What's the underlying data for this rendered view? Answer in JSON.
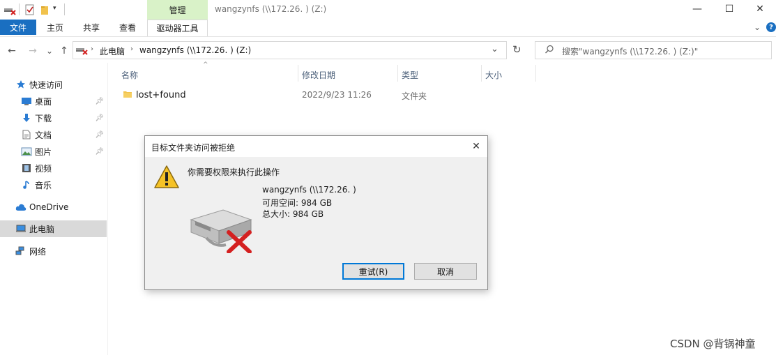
{
  "window": {
    "title": "wangzynfs (\\\\172.26.            ) (Z:)",
    "context_tab": "管理",
    "minimize_glyph": "—",
    "maximize_glyph": "☐",
    "close_glyph": "✕"
  },
  "ribbon": {
    "tabs": [
      "文件",
      "主页",
      "共享",
      "查看",
      "驱动器工具"
    ],
    "file_tab_color": "#1a6fc1",
    "context_tab_color": "#d9f2c8"
  },
  "nav": {
    "back": "←",
    "forward": "→",
    "recent": "⌄",
    "up": "↑"
  },
  "address": {
    "segments": [
      "此电脑",
      "wangzynfs (\\\\172.26.            ) (Z:)"
    ],
    "dropdown": "⌄",
    "refresh": "↻"
  },
  "search": {
    "placeholder": "搜索\"wangzynfs (\\\\172.26.            ) (Z:)\""
  },
  "columns": {
    "name": "名称",
    "date": "修改日期",
    "type": "类型",
    "size": "大小"
  },
  "files": [
    {
      "name": "lost+found",
      "date": "2022/9/23 11:26",
      "type": "文件夹",
      "size": ""
    }
  ],
  "sidebar": {
    "quick_access": "快速访问",
    "items": [
      {
        "label": "桌面",
        "icon": "desktop-icon",
        "pinned": true
      },
      {
        "label": "下载",
        "icon": "download-icon",
        "pinned": true
      },
      {
        "label": "文档",
        "icon": "document-icon",
        "pinned": true
      },
      {
        "label": "图片",
        "icon": "picture-icon",
        "pinned": true
      },
      {
        "label": "视频",
        "icon": "video-icon",
        "pinned": false
      },
      {
        "label": "音乐",
        "icon": "music-icon",
        "pinned": false
      }
    ],
    "onedrive": "OneDrive",
    "this_pc": "此电脑",
    "network": "网络"
  },
  "dialog": {
    "title": "目标文件夹访问被拒绝",
    "message": "你需要权限来执行此操作",
    "drive_name": "wangzynfs (\\\\172.26.            )",
    "free_space": "可用空间: 984 GB",
    "total_size": "总大小: 984 GB",
    "retry_label": "重试(R)",
    "cancel_label": "取消",
    "close_glyph": "✕"
  },
  "watermark": "CSDN @背锅神童"
}
